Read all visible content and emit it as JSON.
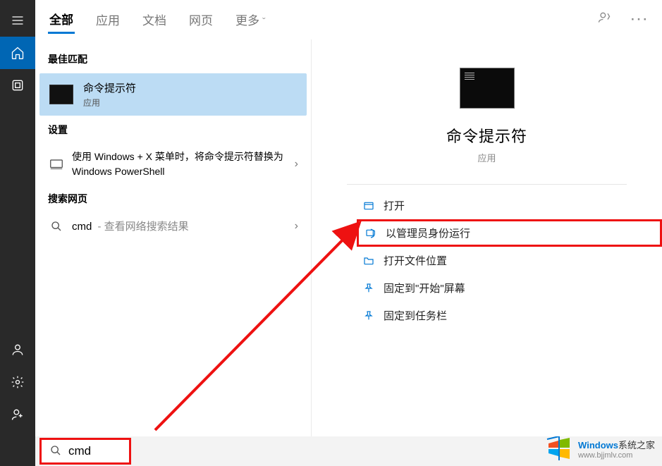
{
  "tabs": {
    "all": "全部",
    "apps": "应用",
    "docs": "文档",
    "web": "网页",
    "more": "更多"
  },
  "sections": {
    "best_match": "最佳匹配",
    "settings": "设置",
    "search_web": "搜索网页"
  },
  "best_match": {
    "title": "命令提示符",
    "subtitle": "应用"
  },
  "settings_item": {
    "text": "使用 Windows + X 菜单时，将命令提示符替换为 Windows PowerShell"
  },
  "web_item": {
    "term": "cmd",
    "hint": "- 查看网络搜索结果"
  },
  "detail": {
    "title": "命令提示符",
    "subtitle": "应用"
  },
  "actions": {
    "open": "打开",
    "run_admin": "以管理员身份运行",
    "open_location": "打开文件位置",
    "pin_start": "固定到\"开始\"屏幕",
    "pin_taskbar": "固定到任务栏"
  },
  "search": {
    "value": "cmd"
  },
  "watermark": {
    "brand": "Windows",
    "suffix": "系统之家",
    "url": "www.bjjmlv.com"
  }
}
